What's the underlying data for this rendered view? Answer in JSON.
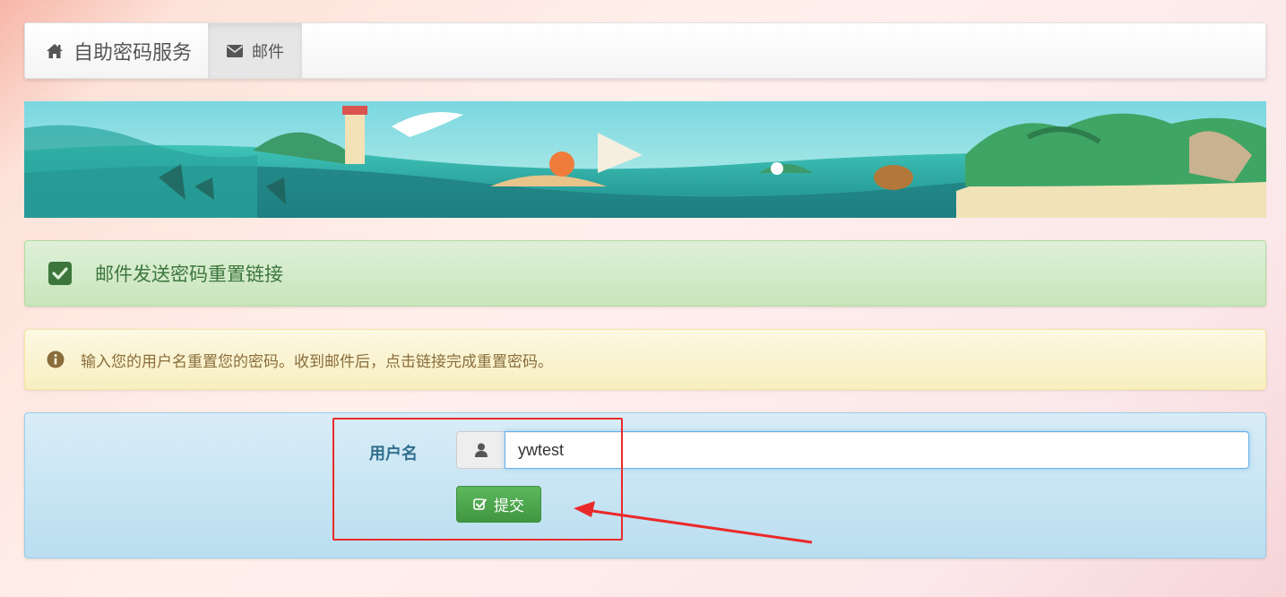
{
  "navbar": {
    "brand_label": "自助密码服务",
    "brand_icon": "home-icon",
    "tabs": [
      {
        "label": "邮件",
        "icon": "envelope-icon",
        "active": true
      }
    ]
  },
  "banner": {
    "description_icon": "ocean-island-banner"
  },
  "alerts": {
    "success": {
      "icon": "check-square-icon",
      "text": "邮件发送密码重置链接"
    },
    "info": {
      "icon": "info-circle-icon",
      "text": "输入您的用户名重置您的密码。收到邮件后，点击链接完成重置密码。"
    }
  },
  "form": {
    "username_label": "用户名",
    "username_icon": "user-icon",
    "username_value": "ywtest",
    "submit_label": "提交",
    "submit_icon": "check-square-o-icon"
  },
  "colors": {
    "success_text": "#3c763d",
    "warning_text": "#8a6d3b",
    "info_label": "#31708f",
    "submit_button": "#5cb85c",
    "annotation": "#ea2a2a"
  }
}
